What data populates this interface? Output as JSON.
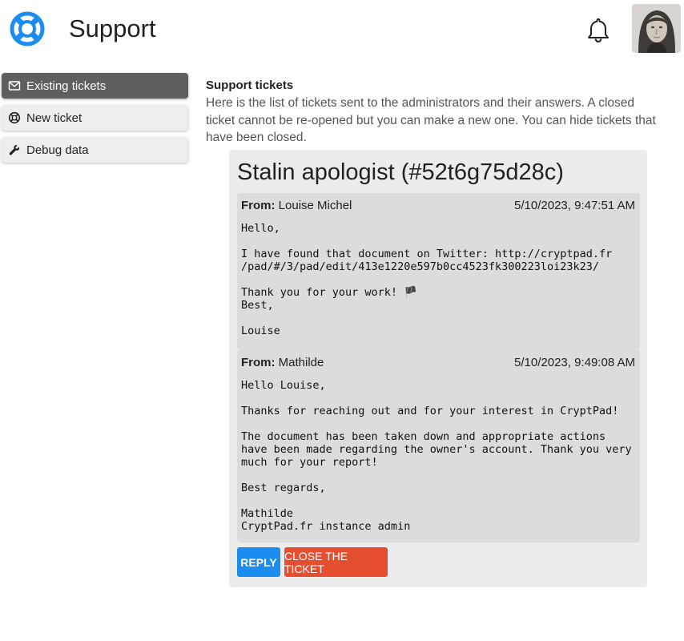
{
  "header": {
    "title": "Support",
    "logo_icon": "lifebuoy-icon",
    "notifications_icon": "bell-icon",
    "accent": "#1b8cf0"
  },
  "sidebar": {
    "items": [
      {
        "label": "Existing tickets",
        "icon": "envelope-icon",
        "active": true
      },
      {
        "label": "New ticket",
        "icon": "lifebuoy-icon",
        "active": false
      },
      {
        "label": "Debug data",
        "icon": "wrench-icon",
        "active": false
      }
    ]
  },
  "main": {
    "section_title": "Support tickets",
    "section_desc": "Here is the list of tickets sent to the administrators and their answers. A closed ticket cannot be re-opened but you can make a new one. You can hide tickets that have been closed."
  },
  "ticket": {
    "title": "Stalin apologist (#52t6g75d28c)",
    "messages": [
      {
        "from_label": "From:",
        "from": "Louise Michel",
        "date": "5/10/2023, 9:47:51 AM",
        "body": "Hello,\n\nI have found that document on Twitter: http://cryptpad.fr\n/pad/#/3/pad/edit/413e1220e597b0cc4523fk300223loi23k23/\n\nThank you for your work! 🏴\nBest,\n\nLouise"
      },
      {
        "from_label": "From:",
        "from": "Mathilde",
        "date": "5/10/2023, 9:49:08 AM",
        "body": "Hello Louise,\n\nThanks for reaching out and for your interest in CryptPad!\n\nThe document has been taken down and appropriate actions\nhave been made regarding the owner's account. Thank you very\nmuch for your report!\n\nBest regards,\n\nMathilde\nCryptPad.fr instance admin"
      }
    ],
    "reply_label": "REPLY",
    "close_label": "CLOSE THE TICKET",
    "reply_color": "#1b8cf0",
    "close_color": "#e54e2f"
  }
}
